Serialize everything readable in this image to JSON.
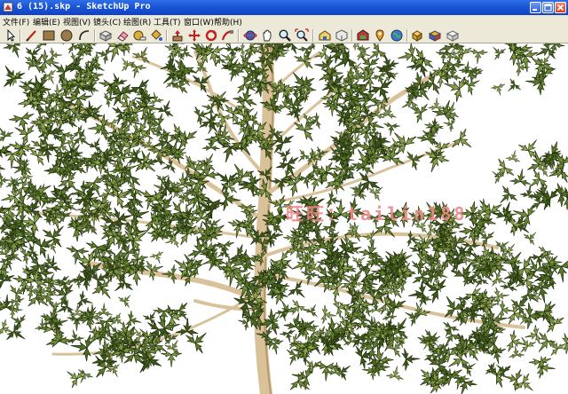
{
  "window": {
    "title": "6 (15).skp - SketchUp Pro",
    "minimize": "minimize",
    "maximize": "maximize",
    "close": "close"
  },
  "menu": [
    {
      "label": "文件(F)",
      "key": "file"
    },
    {
      "label": "编辑(E)",
      "key": "edit"
    },
    {
      "label": "视图(V)",
      "key": "view"
    },
    {
      "label": "镜头(C)",
      "key": "camera"
    },
    {
      "label": "绘图(R)",
      "key": "draw"
    },
    {
      "label": "工具(T)",
      "key": "tools"
    },
    {
      "label": "窗口(W)",
      "key": "window"
    },
    {
      "label": "帮助(H)",
      "key": "help"
    }
  ],
  "toolbar_icons": [
    "select-icon",
    "line-icon",
    "rectangle-icon",
    "circle-icon",
    "arc-icon",
    "make-component-icon",
    "eraser-icon",
    "tape-measure-icon",
    "paint-bucket-icon",
    "push-pull-icon",
    "move-icon",
    "rotate-icon",
    "follow-me-icon",
    "orbit-icon",
    "pan-icon",
    "zoom-icon",
    "zoom-extents-icon",
    "warehouse-icon",
    "share-model-icon",
    "get-photo-icon",
    "location-icon",
    "google-earth-icon",
    "components-icon",
    "style-icon",
    "section-icon"
  ],
  "viewport": {
    "watermark": "旺旺：tailin188"
  },
  "colors": {
    "titlebar": "#1a56d6",
    "chrome": "#ece9d8",
    "leaf_dark": "#4f6b25",
    "leaf_light": "#8aa24a",
    "trunk": "#d9c29a",
    "watermark": "#f08888"
  }
}
